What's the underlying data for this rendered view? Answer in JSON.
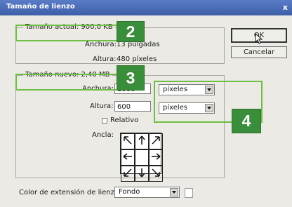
{
  "window": {
    "title": "Tamaño de lienzo",
    "close": "x"
  },
  "current_size": {
    "legend": "Tamaño actual: 900,0 KB",
    "width_label": "Anchura:",
    "width_value": "13 pulgadas",
    "height_label": "Altura:",
    "height_value": "480 píxeles"
  },
  "new_size": {
    "legend": "Tamaño nuevo: 2,40 MB",
    "width_label": "Anchura:",
    "width_value": "1000",
    "height_label": "Altura:",
    "height_value": "600",
    "unit_width": "píxeles",
    "unit_height": "píxeles",
    "relative_label": "Relativo",
    "anchor_label": "Ancla:"
  },
  "buttons": {
    "ok": "OK",
    "cancel": "Cancelar"
  },
  "extension": {
    "label": "Color de extensión de lienzo:",
    "value": "Fondo"
  },
  "badges": {
    "b2": "2",
    "b3": "3",
    "b4": "4"
  },
  "colors": {
    "titlebar": "#4b6fb9",
    "callout_green": "#6fbe45",
    "badge_green": "#3a8d3b"
  }
}
